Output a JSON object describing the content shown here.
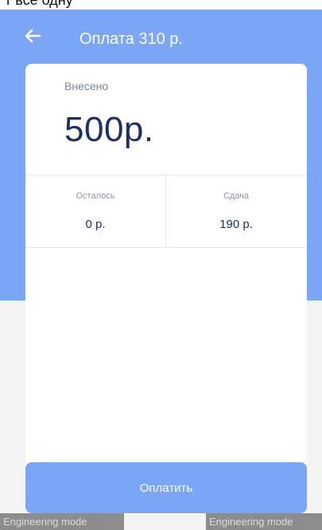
{
  "colors": {
    "primary": "#7ba6f5",
    "text_dark": "#1d2f66",
    "text_muted": "#7b8794"
  },
  "status_bar": {
    "text": "т все одну"
  },
  "header": {
    "back_icon": "arrow-left-icon",
    "title": "Оплата 310 р."
  },
  "payment": {
    "deposited_label": "Внесено",
    "deposited_value": "500р.",
    "remaining_label": "Осталось",
    "remaining_value": "0 р.",
    "change_label": "Сдача",
    "change_value": "190 р."
  },
  "pay_button": {
    "label": "Оплатить"
  },
  "overlay": {
    "left": "Engineering mode",
    "right": "Engineering mode"
  }
}
